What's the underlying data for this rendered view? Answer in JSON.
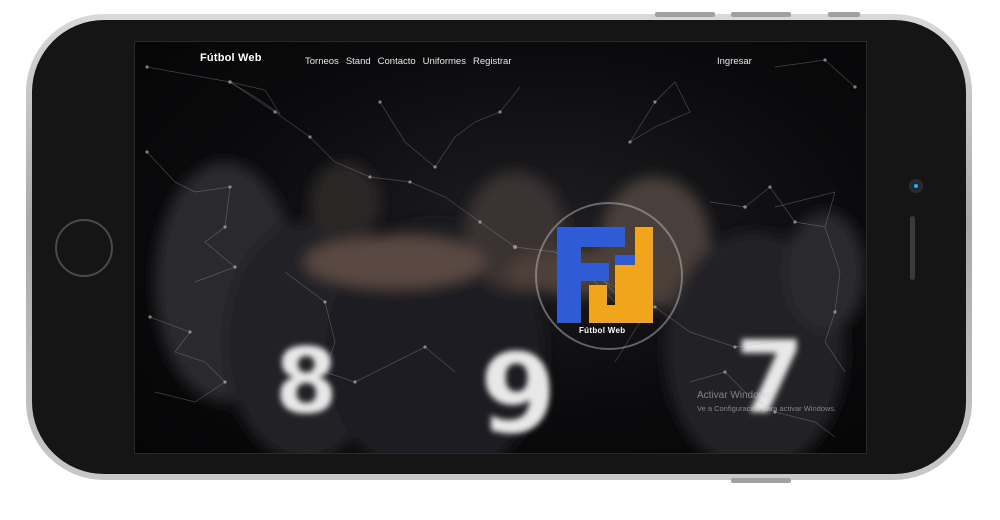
{
  "navbar": {
    "brand": "Fútbol Web",
    "links": [
      "Torneos",
      "Stand",
      "Contacto",
      "Uniformes",
      "Registrar"
    ],
    "login": "Ingresar"
  },
  "logo": {
    "letters": "FW",
    "caption": "Fútbol Web",
    "colors": {
      "blue": "#2f5bd6",
      "orange": "#f0a51c"
    }
  },
  "watermark": {
    "title": "Activar Windows",
    "subtitle": "Ve a Configuración para activar Windows."
  },
  "background": {
    "jersey_numbers": [
      "8",
      "9",
      "7"
    ]
  },
  "device": {
    "frame_color": "#151515",
    "bezel_color": "#b5b5b8",
    "camera_light": "#3aa8e0"
  }
}
